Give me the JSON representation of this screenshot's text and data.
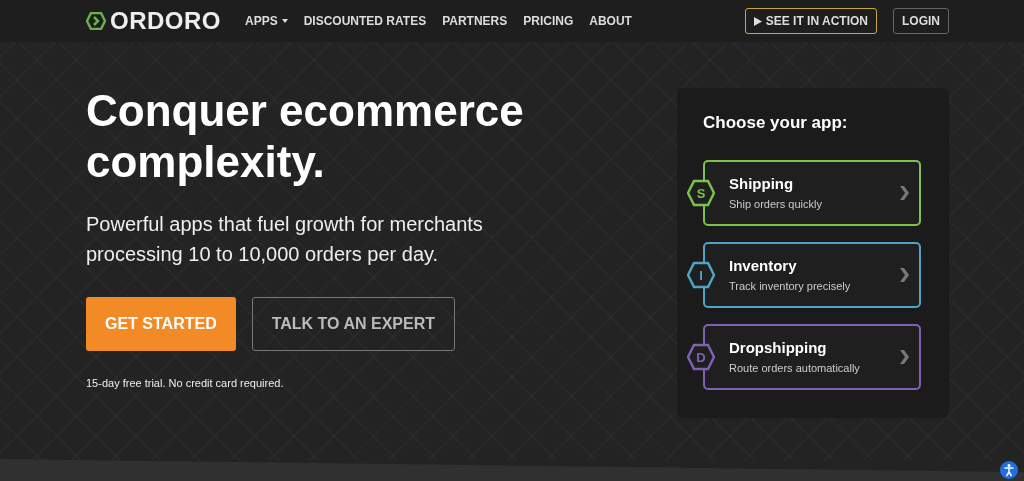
{
  "nav": {
    "brand": "ORDORO",
    "links": [
      {
        "label": "APPS",
        "dropdown": true
      },
      {
        "label": "DISCOUNTED RATES",
        "dropdown": false
      },
      {
        "label": "PARTNERS",
        "dropdown": false
      },
      {
        "label": "PRICING",
        "dropdown": false
      },
      {
        "label": "ABOUT",
        "dropdown": false
      }
    ],
    "demo_button": "SEE IT IN ACTION",
    "login_button": "LOGIN"
  },
  "hero": {
    "headline": "Conquer ecommerce complexity.",
    "subhead": "Powerful apps that fuel growth for merchants processing 10 to 10,000 orders per day.",
    "primary_button": "GET STARTED",
    "secondary_button": "TALK TO AN EXPERT",
    "note": "15-day free trial. No credit card required."
  },
  "app_panel": {
    "title": "Choose your app:",
    "apps": [
      {
        "name": "Shipping",
        "description": "Ship orders quickly",
        "letter": "S",
        "color": "#7dc04b"
      },
      {
        "name": "Inventory",
        "description": "Track inventory precisely",
        "letter": "I",
        "color": "#4fa3c7"
      },
      {
        "name": "Dropshipping",
        "description": "Route orders automatically",
        "letter": "D",
        "color": "#7e61b3"
      }
    ]
  }
}
